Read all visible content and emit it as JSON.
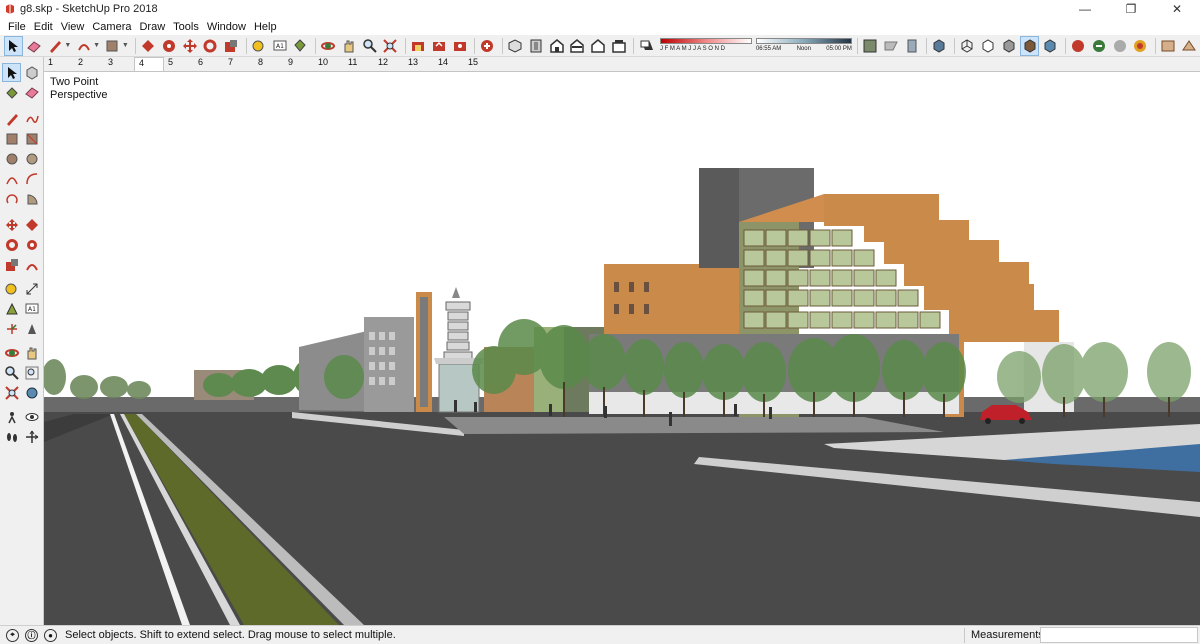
{
  "window": {
    "title": "g8.skp - SketchUp Pro 2018",
    "minimize": "—",
    "maximize": "❐",
    "close": "✕"
  },
  "menu": [
    "File",
    "Edit",
    "View",
    "Camera",
    "Draw",
    "Tools",
    "Window",
    "Help"
  ],
  "shadow": {
    "months": "J F M A M J J A S O N D",
    "time_start": "06:55 AM",
    "time_mid": "Noon",
    "time_end": "05:00 PM"
  },
  "scenes": [
    "1",
    "2",
    "3",
    "4",
    "5",
    "6",
    "7",
    "8",
    "9",
    "10",
    "11",
    "12",
    "13",
    "14",
    "15"
  ],
  "active_scene": "4",
  "viewport": {
    "camera_label": "Two Point Perspective"
  },
  "status": {
    "message": "Select objects. Shift to extend select. Drag mouse to select multiple.",
    "measurements_label": "Measurements",
    "measurements_value": ""
  },
  "colors": {
    "accent": "#cde3f7",
    "road": "#4a4a4a",
    "median_grass": "#5d6a2a",
    "brick": "#c98a4a",
    "water": "#3f6fa0"
  }
}
